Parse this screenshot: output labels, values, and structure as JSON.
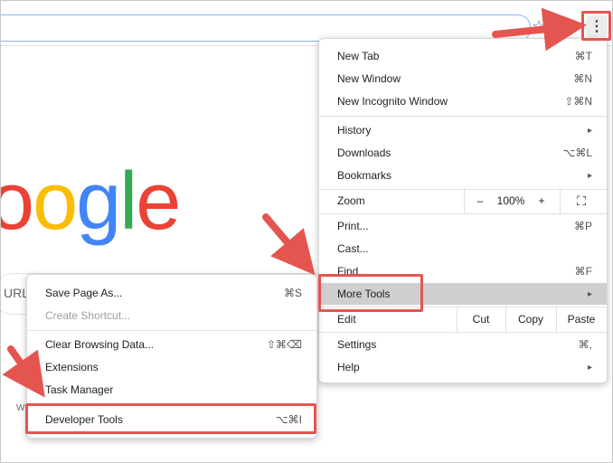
{
  "browser": {
    "star_icon": "star-icon",
    "extension_icon": "extension-icon",
    "menu_button_icon": "three-dot-menu-icon",
    "menu_button_glyph": "⋮"
  },
  "page": {
    "logo_letters": [
      "o",
      "o",
      "g",
      "l",
      "e"
    ],
    "logo_colors": [
      "#ea4335",
      "#fbbc05",
      "#4285f4",
      "#34a853",
      "#ea4335"
    ],
    "search_partial_text": "URL",
    "footer_partial_text": "W"
  },
  "chrome_menu": {
    "new_tab": {
      "label": "New Tab",
      "shortcut": "⌘T"
    },
    "new_window": {
      "label": "New Window",
      "shortcut": "⌘N"
    },
    "new_incognito": {
      "label": "New Incognito Window",
      "shortcut": "⇧⌘N"
    },
    "history": {
      "label": "History",
      "arrow": "▸"
    },
    "downloads": {
      "label": "Downloads",
      "shortcut": "⌥⌘L"
    },
    "bookmarks": {
      "label": "Bookmarks",
      "arrow": "▸"
    },
    "zoom": {
      "label": "Zoom",
      "minus": "–",
      "value": "100%",
      "plus": "+",
      "fullscreen": "⛶"
    },
    "print": {
      "label": "Print...",
      "shortcut": "⌘P"
    },
    "cast": {
      "label": "Cast..."
    },
    "find": {
      "label": "Find...",
      "shortcut": "⌘F"
    },
    "more_tools": {
      "label": "More Tools",
      "arrow": "▸"
    },
    "edit": {
      "label": "Edit",
      "cut": "Cut",
      "copy": "Copy",
      "paste": "Paste"
    },
    "settings": {
      "label": "Settings",
      "shortcut": "⌘,"
    },
    "help": {
      "label": "Help",
      "arrow": "▸"
    }
  },
  "more_tools_menu": {
    "save_page": {
      "label": "Save Page As...",
      "shortcut": "⌘S"
    },
    "create_shortcut": {
      "label": "Create Shortcut..."
    },
    "clear_data": {
      "label": "Clear Browsing Data...",
      "shortcut": "⇧⌘⌫"
    },
    "extensions": {
      "label": "Extensions"
    },
    "task_manager": {
      "label": "Task Manager"
    },
    "developer_tools": {
      "label": "Developer Tools",
      "shortcut": "⌥⌘I"
    }
  },
  "colors": {
    "annotation": "#e5554f",
    "selected_row": "#cfcfcf"
  }
}
